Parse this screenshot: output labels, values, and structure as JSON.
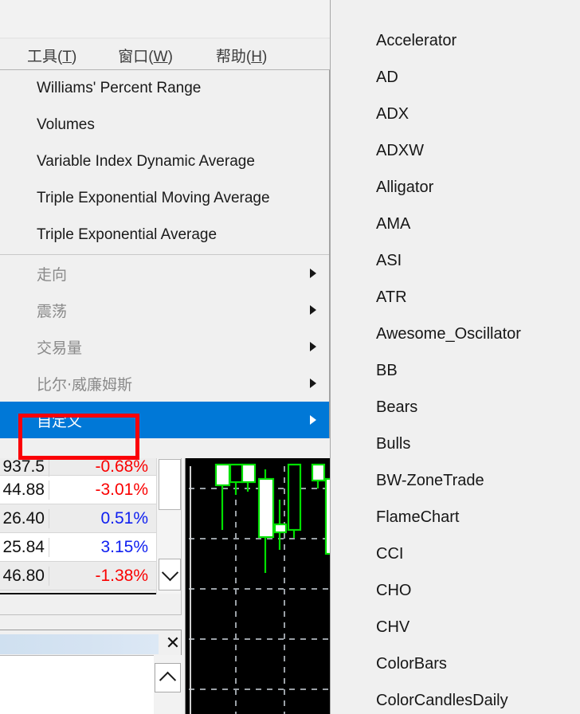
{
  "menubar": {
    "items": [
      {
        "label": "工具",
        "accel": "T"
      },
      {
        "label": "窗口",
        "accel": "W"
      },
      {
        "label": "帮助",
        "accel": "H"
      }
    ]
  },
  "dropdown": {
    "indicator_items": [
      {
        "label": "Williams' Percent Range"
      },
      {
        "label": "Volumes"
      },
      {
        "label": "Variable Index Dynamic Average"
      },
      {
        "label": "Triple Exponential Moving Average"
      },
      {
        "label": "Triple Exponential Average"
      }
    ],
    "category_items": [
      {
        "label": "走向",
        "selected": false
      },
      {
        "label": "震荡",
        "selected": false
      },
      {
        "label": "交易量",
        "selected": false
      },
      {
        "label": "比尔·威廉姆斯",
        "selected": false
      },
      {
        "label": "自定义",
        "selected": true
      }
    ],
    "highlight_color": "#0078d7",
    "annotation_color": "#fb0007"
  },
  "indicator_panel": {
    "scroll_up_icon": "triangle-up-icon",
    "items": [
      {
        "label": "Accelerator"
      },
      {
        "label": "AD"
      },
      {
        "label": "ADX"
      },
      {
        "label": "ADXW"
      },
      {
        "label": "Alligator"
      },
      {
        "label": "AMA"
      },
      {
        "label": "ASI"
      },
      {
        "label": "ATR"
      },
      {
        "label": "Awesome_Oscillator"
      },
      {
        "label": "BB"
      },
      {
        "label": "Bears"
      },
      {
        "label": "Bulls"
      },
      {
        "label": "BW-ZoneTrade"
      },
      {
        "label": "FlameChart"
      },
      {
        "label": "CCI"
      },
      {
        "label": "CHO"
      },
      {
        "label": "CHV"
      },
      {
        "label": "ColorBars"
      },
      {
        "label": "ColorCandlesDaily"
      }
    ]
  },
  "market_watch": {
    "rows": [
      {
        "price": "937.5",
        "change": "-0.68%",
        "direction": "neg"
      },
      {
        "price": "44.88",
        "change": "-3.01%",
        "direction": "neg"
      },
      {
        "price": "26.40",
        "change": "0.51%",
        "direction": "pos"
      },
      {
        "price": "25.84",
        "change": "3.15%",
        "direction": "pos"
      },
      {
        "price": "46.80",
        "change": "-1.38%",
        "direction": "neg"
      }
    ],
    "scroll_down_icon": "chevron-down-icon",
    "negative_color": "#fa0000",
    "positive_color": "#1020f0"
  },
  "terminal_panel": {
    "close_icon": "close-icon",
    "close_label": "✕",
    "scroll_up_icon": "chevron-up-icon"
  },
  "chart": {
    "background_color": "#000000",
    "candle_outline_color": "#00e000",
    "candle_body_color": "#ffffff",
    "grid_color": "#9aa0a6",
    "candles": [
      {
        "x": 0,
        "open": 28,
        "close": 5,
        "high": 5,
        "heigh_low": 132,
        "low": 132
      },
      {
        "x": 1,
        "open": 28,
        "close": 0,
        "high": 0,
        "low": 110
      },
      {
        "x": 2,
        "open": 28,
        "close": 5,
        "high": 5,
        "low": 95
      },
      {
        "x": 3,
        "open": 108,
        "close": 22,
        "high": 10,
        "low": 178
      },
      {
        "x": 4,
        "open": 98,
        "close": 88,
        "high": 58,
        "low": 145
      },
      {
        "x": 5,
        "open": 98,
        "close": 0,
        "high": 0,
        "low": 118
      },
      {
        "x": 6,
        "open": 28,
        "close": 5,
        "high": 5,
        "low": 38
      },
      {
        "x": 7,
        "open": 120,
        "close": 20,
        "high": 20,
        "low": 128
      }
    ]
  }
}
